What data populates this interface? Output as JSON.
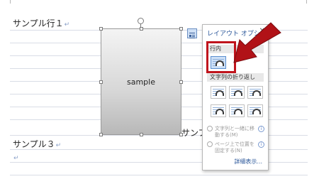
{
  "document": {
    "lines": [
      {
        "text": "サンプル行１",
        "mark": "↵"
      },
      {
        "text": "サンプ",
        "mark": ""
      },
      {
        "text": "サンプル３",
        "mark": "↵"
      },
      {
        "text": "",
        "mark": "↵"
      }
    ],
    "image_label": "sample"
  },
  "layout_options": {
    "title": "レイアウト オプション",
    "close": "✕",
    "inline_section": "行内",
    "wrap_section": "文字列の折り返し",
    "radio_move": "文字列と一緒に移動する(M)",
    "radio_fix": "ページ上で位置を固定する(N)",
    "detail_link": "詳細表示..."
  },
  "colors": {
    "accent": "#2b579a",
    "highlight": "#c0141c",
    "arrow": "#b11217"
  }
}
